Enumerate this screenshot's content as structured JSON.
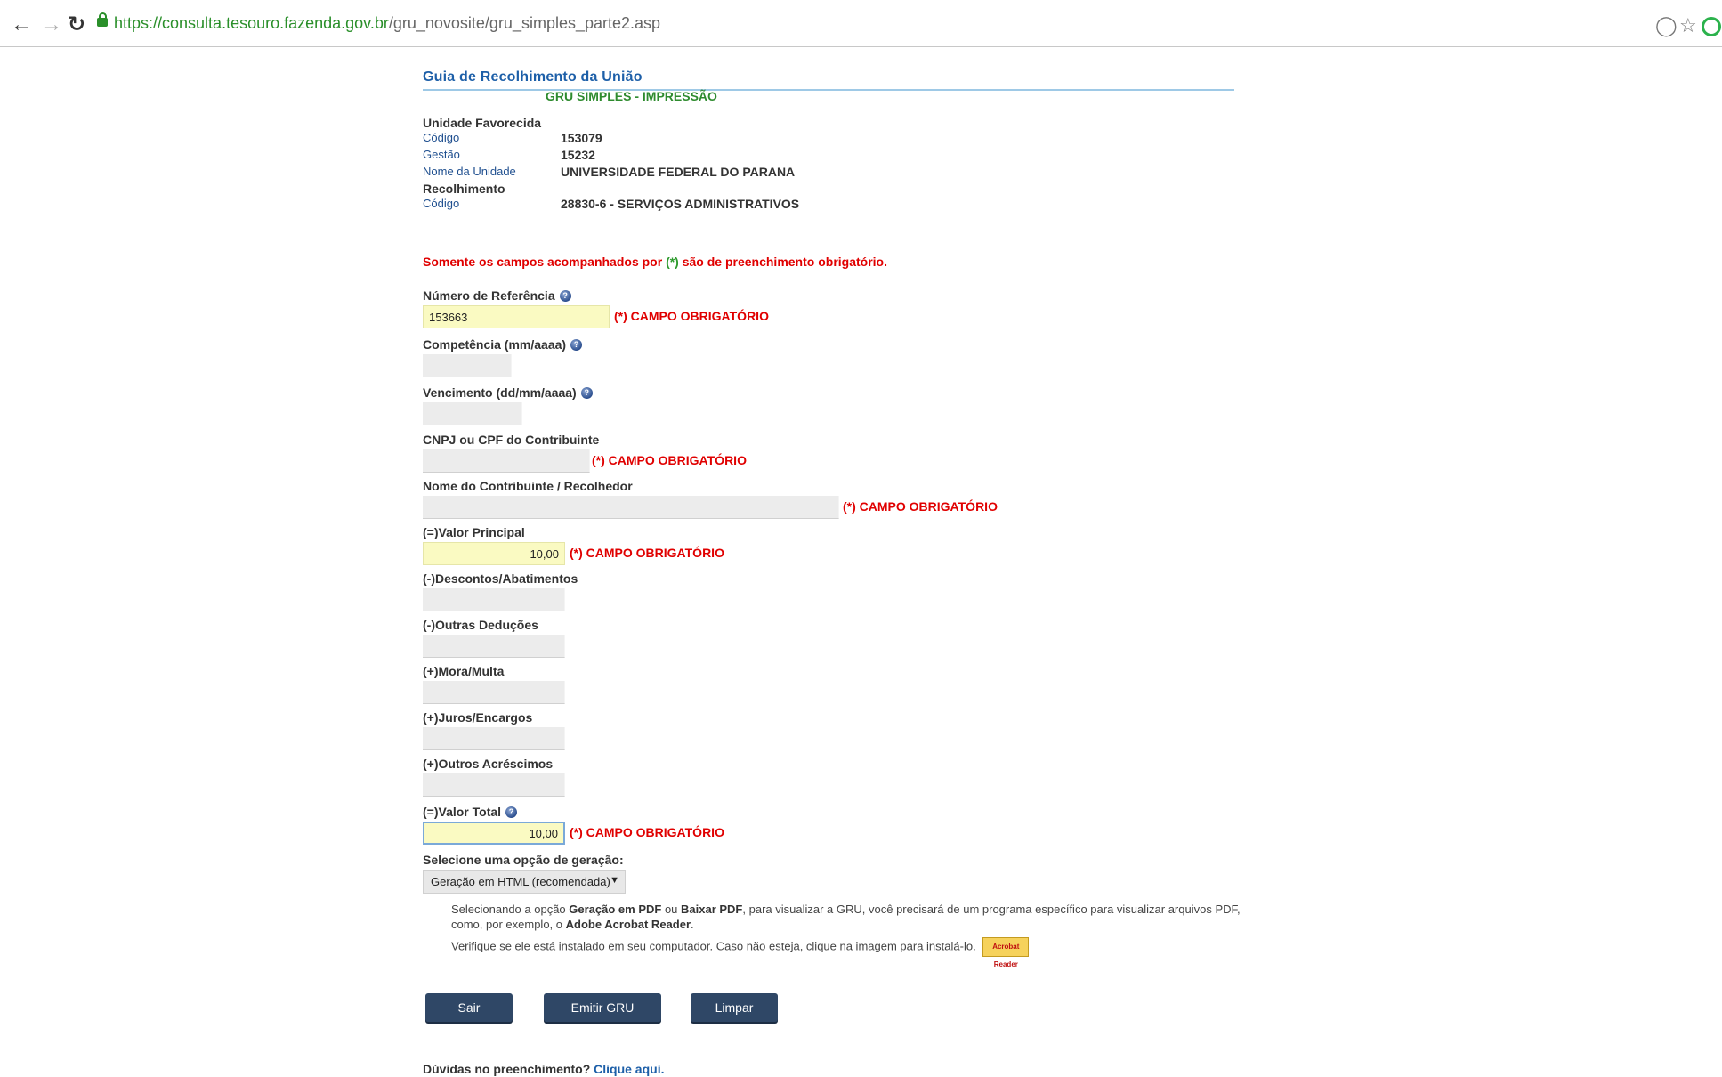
{
  "browser": {
    "url_host": "https://consulta.tesouro.fazenda.gov.br",
    "url_path": "/gru_novosite/gru_simples_parte2.asp"
  },
  "header": {
    "title": "Guia de Recolhimento da União",
    "subtitle": "GRU SIMPLES - IMPRESSÃO"
  },
  "unidade": {
    "heading": "Unidade Favorecida",
    "codigo_label": "Código",
    "codigo_value": "153079",
    "gestao_label": "Gestão",
    "gestao_value": "15232",
    "nome_label": "Nome da Unidade",
    "nome_value": "UNIVERSIDADE FEDERAL DO PARANA"
  },
  "recolhimento": {
    "heading": "Recolhimento",
    "codigo_label": "Código",
    "codigo_value": "28830-6 - SERVIÇOS ADMINISTRATIVOS"
  },
  "notice": {
    "before": "Somente os campos acompanhados por ",
    "mark": "(*)",
    "after": " são de preenchimento obrigatório."
  },
  "required_text": "(*) CAMPO OBRIGATÓRIO",
  "fields": {
    "referencia": {
      "label": "Número de Referência",
      "value": "153663"
    },
    "competencia": {
      "label": "Competência (mm/aaaa)",
      "value": ""
    },
    "vencimento": {
      "label": "Vencimento (dd/mm/aaaa)",
      "value": ""
    },
    "cnpj": {
      "label": "CNPJ ou CPF do Contribuinte",
      "value": ""
    },
    "nome": {
      "label": "Nome do Contribuinte / Recolhedor",
      "value": ""
    },
    "valor_principal": {
      "label": "(=)Valor Principal",
      "value": "10,00"
    },
    "descontos": {
      "label": "(-)Descontos/Abatimentos",
      "value": ""
    },
    "deducoes": {
      "label": "(-)Outras Deduções",
      "value": ""
    },
    "mora": {
      "label": "(+)Mora/Multa",
      "value": ""
    },
    "juros": {
      "label": "(+)Juros/Encargos",
      "value": ""
    },
    "acrescimos": {
      "label": "(+)Outros Acréscimos",
      "value": ""
    },
    "valor_total": {
      "label": "(=)Valor Total",
      "value": "10,00"
    }
  },
  "geracao": {
    "label": "Selecione uma opção de geração:",
    "selected": "Geração em HTML (recomendada)"
  },
  "hint": {
    "p1_a": "Selecionando a opção ",
    "p1_b": "Geração em PDF",
    "p1_c": " ou ",
    "p1_d": "Baixar PDF",
    "p1_e": ", para visualizar a GRU, você precisará de um programa específico para visualizar arquivos PDF, como, por exemplo, o ",
    "p1_f": "Adobe Acrobat Reader",
    "p1_g": ".",
    "p2": "Verifique se ele está instalado em seu computador. Caso não esteja, clique na imagem para instalá-lo.",
    "acrobat_text": "Acrobat Reader"
  },
  "buttons": {
    "sair": "Sair",
    "emitir": "Emitir GRU",
    "limpar": "Limpar"
  },
  "footer": {
    "question": "Dúvidas no preenchimento? ",
    "link": "Clique aqui."
  }
}
